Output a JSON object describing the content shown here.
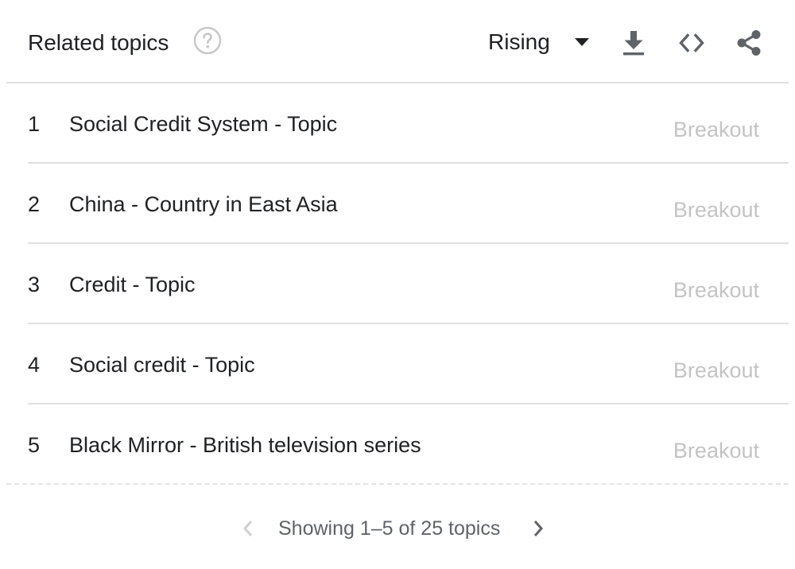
{
  "header": {
    "title": "Related topics",
    "mode": "Rising",
    "icons": {
      "help": "help-circle-icon",
      "caret": "caret-down-icon",
      "download": "download-icon",
      "embed": "code-icon",
      "share": "share-icon"
    }
  },
  "rows": [
    {
      "rank": "1",
      "topic": "Social Credit System - Topic",
      "value": "Breakout"
    },
    {
      "rank": "2",
      "topic": "China - Country in East Asia",
      "value": "Breakout"
    },
    {
      "rank": "3",
      "topic": "Credit - Topic",
      "value": "Breakout"
    },
    {
      "rank": "4",
      "topic": "Social credit - Topic",
      "value": "Breakout"
    },
    {
      "rank": "5",
      "topic": "Black Mirror - British television series",
      "value": "Breakout"
    }
  ],
  "pager": {
    "text": "Showing 1–5 of 25 topics",
    "prev_icon": "chevron-left-icon",
    "next_icon": "chevron-right-icon"
  },
  "colors": {
    "text": "#202124",
    "muted_value": "#c4c4c4",
    "icon": "#5f6368",
    "disabled_icon": "#c8c8c8",
    "divider": "#e0e0e0"
  }
}
